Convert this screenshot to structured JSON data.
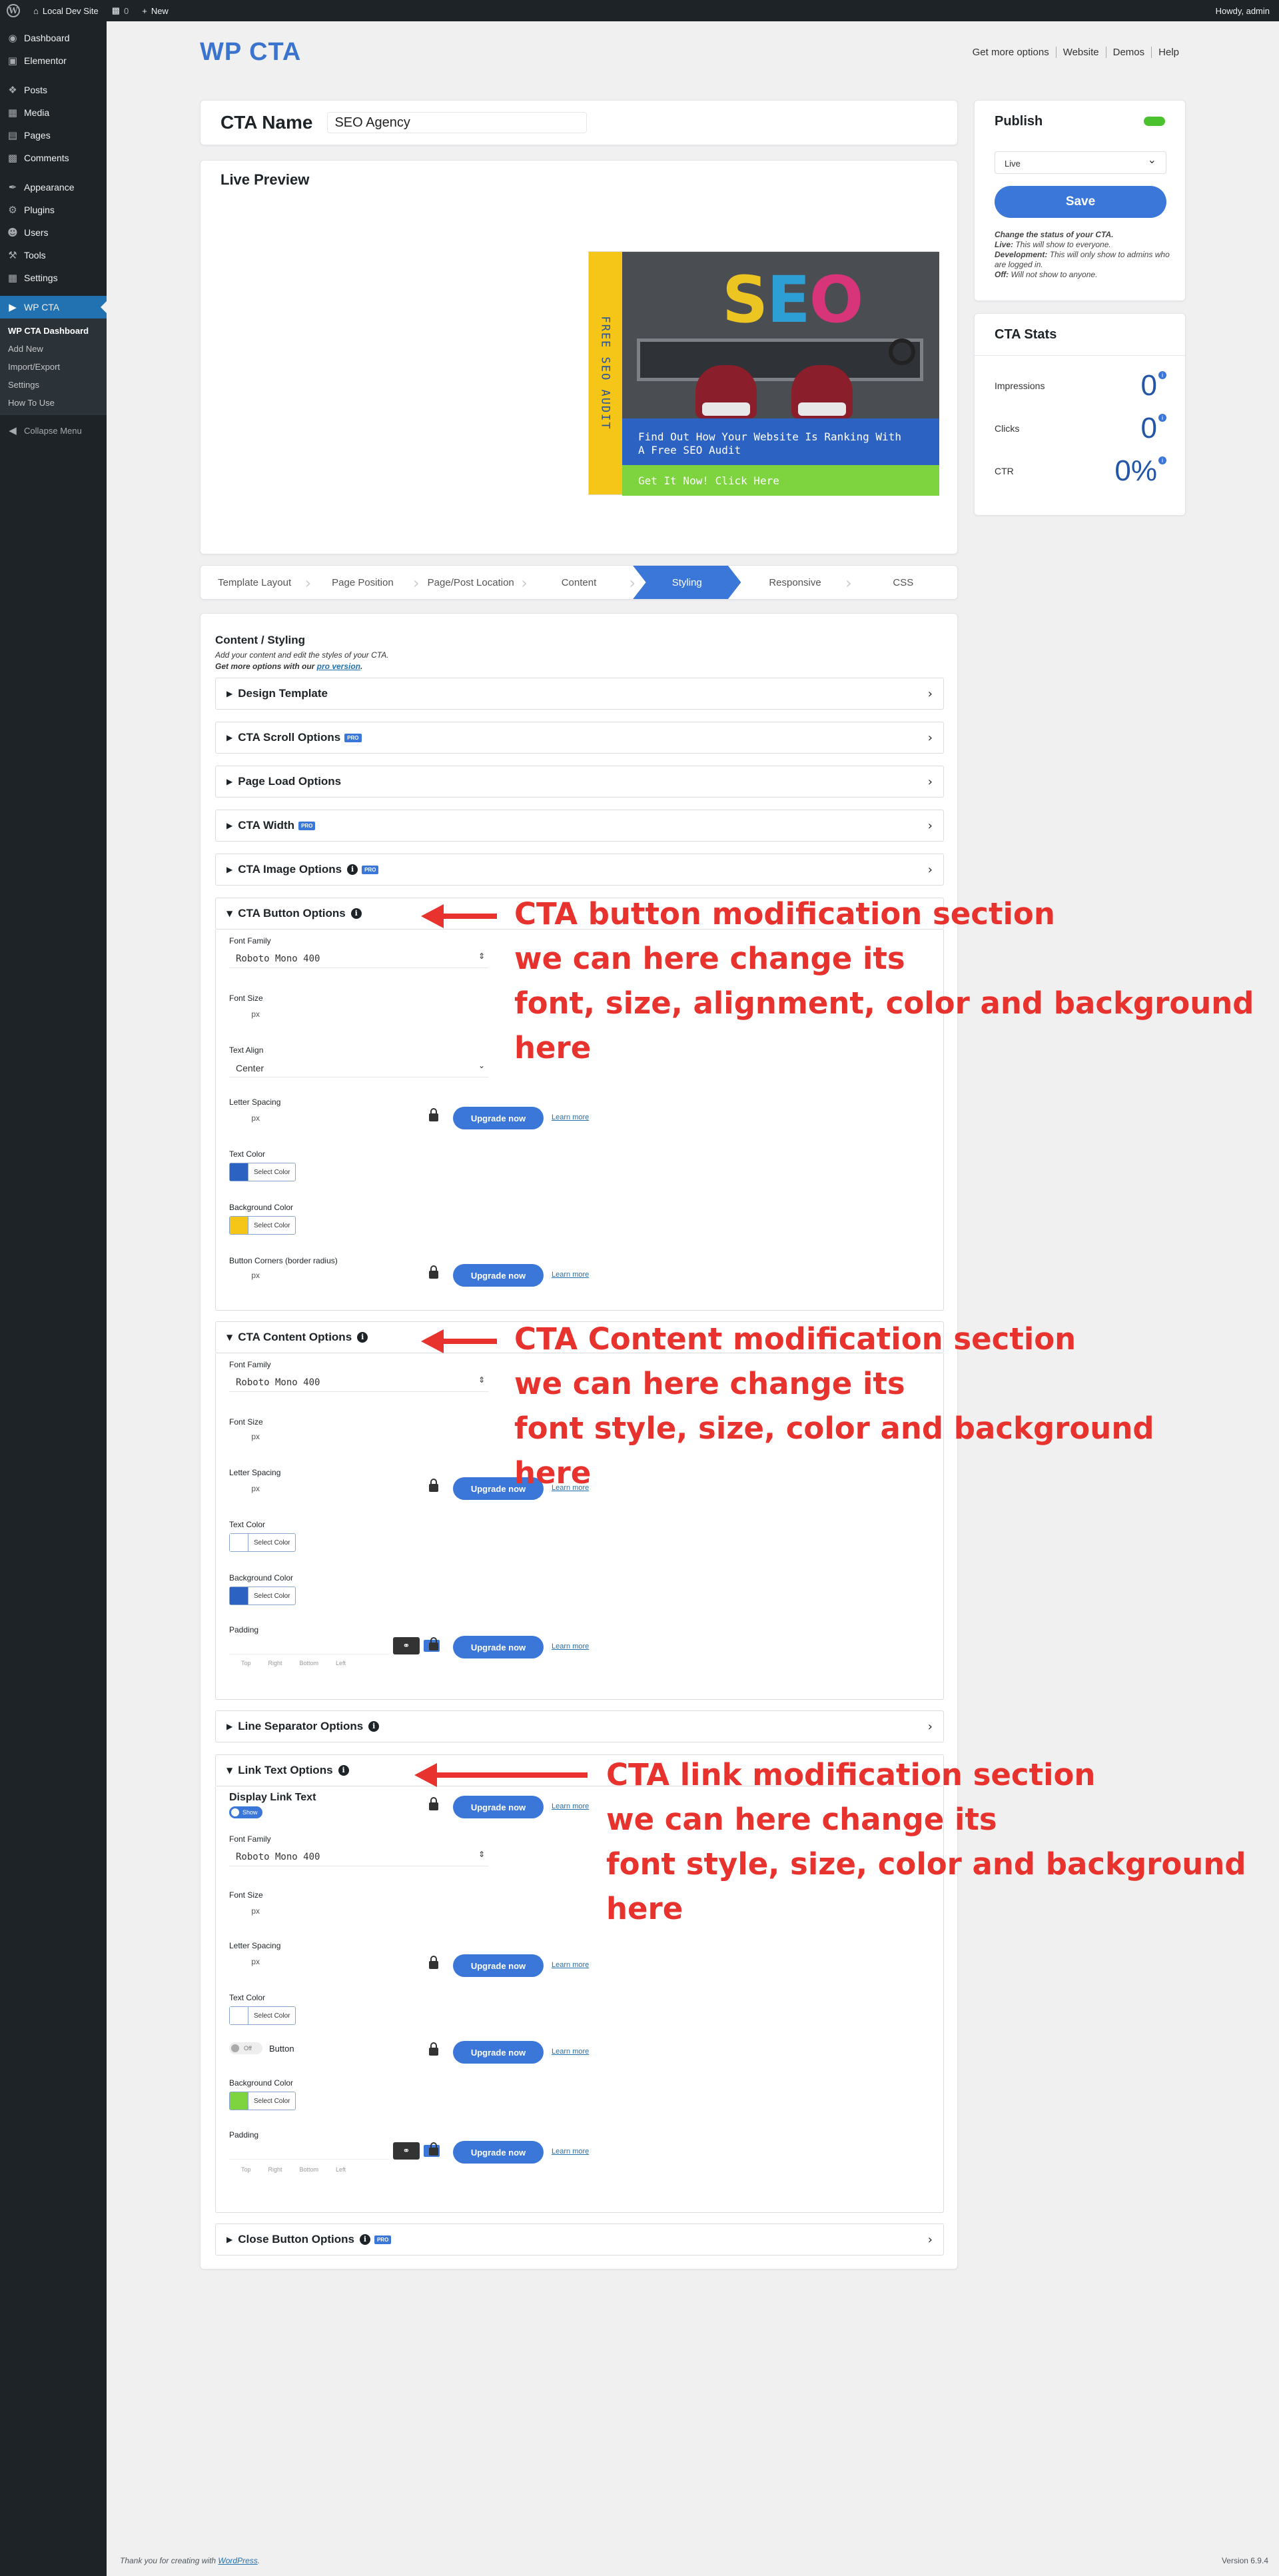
{
  "adminbar": {
    "site_name": "Local Dev Site",
    "comments_count": "0",
    "new_label": "New",
    "howdy": "Howdy, admin"
  },
  "sidebar": {
    "items": [
      "Dashboard",
      "Elementor",
      "Posts",
      "Media",
      "Pages",
      "Comments",
      "Appearance",
      "Plugins",
      "Users",
      "Tools",
      "Settings",
      "WP CTA"
    ],
    "submenu": [
      "WP CTA Dashboard",
      "Add New",
      "Import/Export",
      "Settings",
      "How To Use"
    ],
    "collapse": "Collapse Menu"
  },
  "header": {
    "logo": "WP CTA",
    "nav": [
      "Get more options",
      "Website",
      "Demos",
      "Help"
    ]
  },
  "cta_name": {
    "label": "CTA Name",
    "value": "SEO Agency"
  },
  "preview": {
    "title": "Live Preview",
    "side_text": "FREE SEO AUDIT",
    "image_text": "SEO",
    "content_text_1": "Find Out How Your Website Is Ranking With",
    "content_text_2": "A Free SEO Audit",
    "button_text": "Get It Now! Click Here"
  },
  "publish": {
    "title": "Publish",
    "status": "Live",
    "save": "Save",
    "help_intro": "Change the status of your CTA.",
    "help_live_k": "Live:",
    "help_live": " This will show to everyone.",
    "help_dev_k": "Development:",
    "help_dev": " This will only show to admins who are logged in.",
    "help_off_k": "Off:",
    "help_off": " Will not show to anyone."
  },
  "stats": {
    "title": "CTA Stats",
    "items": [
      {
        "label": "Impressions",
        "value": "0"
      },
      {
        "label": "Clicks",
        "value": "0"
      },
      {
        "label": "CTR",
        "value": "0%"
      }
    ]
  },
  "tabs": [
    "Template Layout",
    "Page Position",
    "Page/Post Location",
    "Content",
    "Styling",
    "Responsive",
    "CSS"
  ],
  "content": {
    "title": "Content / Styling",
    "desc1": "Add your content and edit the styles of your CTA.",
    "desc2": "Get more options with our ",
    "desc_link": "pro version",
    "pro_badge": "PRO",
    "sections": {
      "design": "Design Template",
      "scroll": "CTA Scroll Options",
      "pageload": "Page Load Options",
      "width": "CTA Width",
      "image": "CTA Image Options",
      "button": "CTA Button Options",
      "content": "CTA Content Options",
      "separator": "Line Separator Options",
      "link": "Link Text Options",
      "close": "Close Button Options"
    },
    "labels": {
      "font_family": "Font Family",
      "font_size": "Font Size",
      "text_align": "Text Align",
      "letter_spacing": "Letter Spacing",
      "text_color": "Text Color",
      "background_color": "Background Color",
      "button_corners": "Button Corners (border radius)",
      "padding": "Padding",
      "display_link_text": "Display Link Text",
      "button": "Button"
    },
    "font_value": "Roboto Mono 400",
    "align_value": "Center",
    "unit": "px",
    "select_color": "Select Color",
    "upgrade": "Upgrade now",
    "learn_more": "Learn more",
    "switch_show": "Show",
    "switch_off": "Off",
    "padding_unit": "px",
    "padding_labels": [
      "Top",
      "Right",
      "Bottom",
      "Left"
    ]
  },
  "annotations": {
    "button": [
      "CTA button modification section",
      "we can here change its",
      "font, size, alignment, color and background",
      "here"
    ],
    "content": [
      "CTA Content modification section",
      "we can here change its",
      "font style, size, color and background",
      "here"
    ],
    "link": [
      "CTA link modification section",
      "we can here change its",
      "font style, size, color and background",
      "here"
    ]
  },
  "colors": {
    "accent": "#3b77d8",
    "cta_blue": "#2c63c2",
    "cta_yellow": "#f5c518",
    "cta_green": "#7ed43f",
    "annotation_red": "#e8322e"
  },
  "footer": {
    "thanks": "Thank you for creating with ",
    "wp": "WordPress",
    "version": "Version 6.9.4"
  }
}
